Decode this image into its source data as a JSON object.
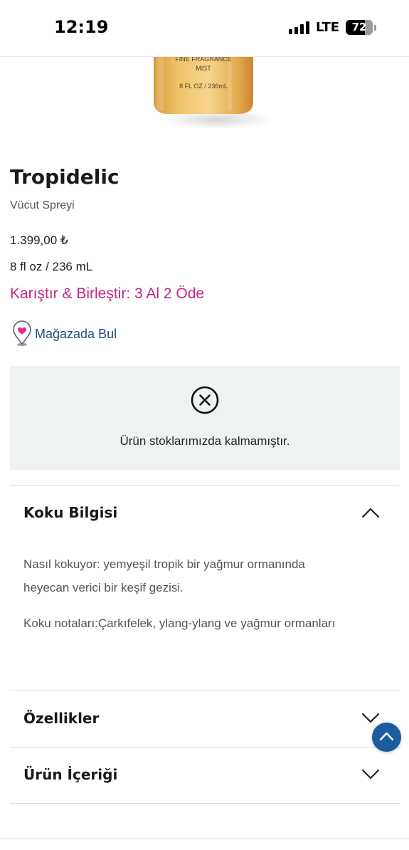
{
  "status_bar": {
    "time": "12:19",
    "network": "LTE",
    "battery_percent": "72",
    "battery_level": 0.72
  },
  "product_image": {
    "line1": "FINE FRAGRANCE",
    "line2": "MIST",
    "line3": "8 FL OZ / 236mL"
  },
  "product": {
    "title": "Tropidelic",
    "subtitle": "Vücut Spreyi",
    "price": "1.399,00 ₺",
    "size": "8 fl oz / 236 mL",
    "promo": "Karıştır & Birleştir: 3 Al 2 Öde",
    "store_link": "Mağazada Bul"
  },
  "stock": {
    "message": "Ürün stoklarımızda kalmamıştır."
  },
  "accordions": {
    "scent": {
      "title": "Koku Bilgisi",
      "expanded": true,
      "paragraph1": "Nasıl kokuyor: yemyeşil tropik bir yağmur ormanında heyecan verici bir keşif gezisi.",
      "paragraph2": "Koku notaları:Çarkıfelek, ylang-ylang ve yağmur ormanları"
    },
    "features": {
      "title": "Özellikler",
      "expanded": false
    },
    "ingredients": {
      "title": "Ürün İçeriği",
      "expanded": false
    }
  },
  "colors": {
    "promo": "#c0287f",
    "link": "#1f4e79",
    "stock_bg": "#eef2f2",
    "scroll_button": "#1b5da0"
  },
  "icons": {
    "store": "map-pin-heart-icon",
    "stock": "x-circle-icon",
    "expanded": "chevron-up-icon",
    "collapsed": "chevron-down-icon",
    "scroll": "arrow-up-icon"
  }
}
